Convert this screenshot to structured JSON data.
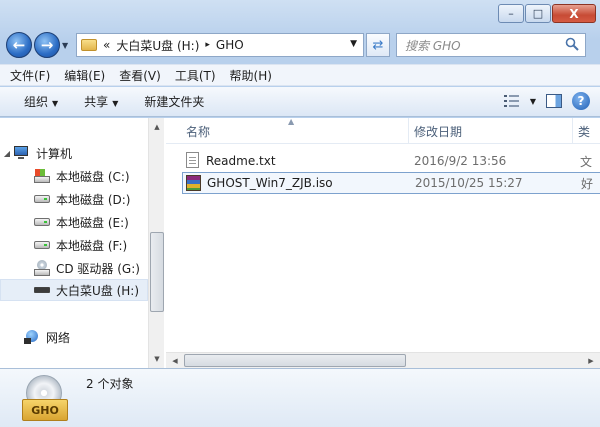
{
  "window": {
    "caption": {
      "minimize": "–",
      "maximize": "□",
      "close": "X"
    }
  },
  "nav": {
    "back": "←",
    "forward": "→",
    "address": {
      "prefix": "«",
      "path": [
        "大白菜U盘 (H:)",
        "GHO"
      ],
      "separator": "▸"
    },
    "search_placeholder": "搜索 GHO"
  },
  "menu": [
    "文件(F)",
    "编辑(E)",
    "查看(V)",
    "工具(T)",
    "帮助(H)"
  ],
  "toolbar": {
    "organize": "组织",
    "share": "共享",
    "new_folder": "新建文件夹",
    "help": "?"
  },
  "sidebar": {
    "computer": "计算机",
    "drives": [
      {
        "label": "本地磁盘 (C:)",
        "icon": "os-drive-icon"
      },
      {
        "label": "本地磁盘 (D:)",
        "icon": "drive-icon"
      },
      {
        "label": "本地磁盘 (E:)",
        "icon": "drive-icon"
      },
      {
        "label": "本地磁盘 (F:)",
        "icon": "drive-icon"
      },
      {
        "label": "CD 驱动器 (G:)",
        "icon": "cd-drive-icon"
      },
      {
        "label": "大白菜U盘 (H:)",
        "icon": "usb-drive-icon",
        "selected": true
      }
    ],
    "network": "网络"
  },
  "columns": {
    "name": "名称",
    "date": "修改日期",
    "type": "类"
  },
  "files": [
    {
      "name": "Readme.txt",
      "date": "2016/9/2 13:56",
      "type": "文",
      "icon": "text-file-icon"
    },
    {
      "name": "GHOST_Win7_ZJB.iso",
      "date": "2015/10/25 15:27",
      "type": "好",
      "icon": "archive-file-icon",
      "highlighted": true
    }
  ],
  "status": {
    "icon_label": "GHO",
    "count": "2 个对象"
  },
  "colors": {
    "accent": "#3b7bc8",
    "frame": "#b9d1ea",
    "selection": "#7da2ce"
  }
}
